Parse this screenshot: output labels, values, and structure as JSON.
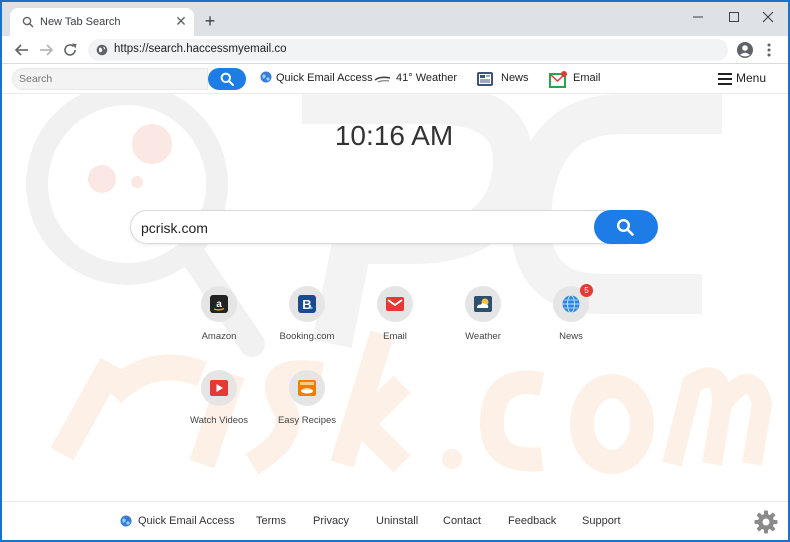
{
  "browser": {
    "tab_title": "New Tab Search",
    "url": "https://search.haccessmyemail.co"
  },
  "topnav": {
    "search_placeholder": "Search",
    "quick_email": "Quick Email Access",
    "weather": "41° Weather",
    "news": "News",
    "email": "Email",
    "menu": "Menu"
  },
  "clock": "10:16 AM",
  "main_search": {
    "value": "pcrisk.com"
  },
  "tiles": [
    {
      "label": "Amazon",
      "icon": "amazon-icon"
    },
    {
      "label": "Booking.com",
      "icon": "booking-icon"
    },
    {
      "label": "Email",
      "icon": "email-icon"
    },
    {
      "label": "Weather",
      "icon": "weather-icon"
    },
    {
      "label": "News",
      "icon": "news-globe-icon",
      "badge": "5"
    },
    {
      "label": "Watch Videos",
      "icon": "video-play-icon"
    },
    {
      "label": "Easy Recipes",
      "icon": "recipes-icon"
    }
  ],
  "footer": {
    "quick_email": "Quick Email Access",
    "terms": "Terms",
    "privacy": "Privacy",
    "uninstall": "Uninstall",
    "contact": "Contact",
    "feedback": "Feedback",
    "support": "Support"
  },
  "colors": {
    "accent": "#1d7ce6",
    "window_border": "#1a73c9",
    "badge": "#e53935"
  }
}
